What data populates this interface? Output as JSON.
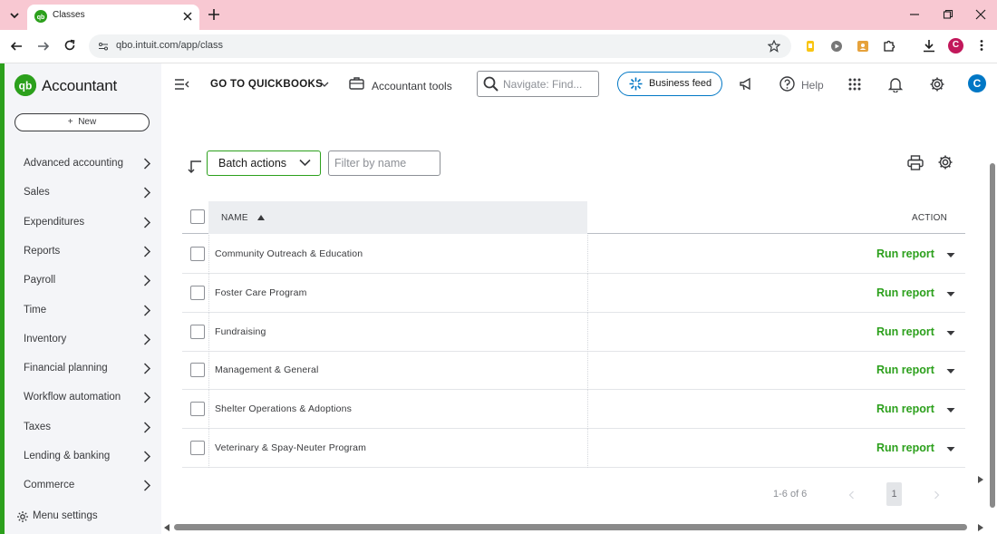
{
  "browser": {
    "tab_title": "Classes",
    "url": "qbo.intuit.com/app/class",
    "profile_initial": "C"
  },
  "sidebar": {
    "brand": "Accountant",
    "new_label": "New",
    "items": [
      {
        "label": "Advanced accounting"
      },
      {
        "label": "Sales"
      },
      {
        "label": "Expenditures"
      },
      {
        "label": "Reports"
      },
      {
        "label": "Payroll"
      },
      {
        "label": "Time"
      },
      {
        "label": "Inventory"
      },
      {
        "label": "Financial planning"
      },
      {
        "label": "Workflow automation"
      },
      {
        "label": "Taxes"
      },
      {
        "label": "Lending & banking"
      },
      {
        "label": "Commerce"
      }
    ],
    "menu_settings": "Menu settings"
  },
  "header": {
    "go_to_quickbooks": "GO TO QUICKBOOKS",
    "accountant_tools": "Accountant tools",
    "search_placeholder": "Navigate: Find...",
    "business_feed": "Business feed",
    "help": "Help",
    "avatar_initial": "C"
  },
  "toolbar": {
    "batch_actions": "Batch actions",
    "filter_placeholder": "Filter by name"
  },
  "table": {
    "col_name": "NAME",
    "col_action": "ACTION",
    "rows": [
      {
        "name": "Community Outreach & Education",
        "action": "Run report"
      },
      {
        "name": "Foster Care Program",
        "action": "Run report"
      },
      {
        "name": "Fundraising",
        "action": "Run report"
      },
      {
        "name": "Management & General",
        "action": "Run report"
      },
      {
        "name": "Shelter Operations & Adoptions",
        "action": "Run report"
      },
      {
        "name": "Veterinary & Spay-Neuter Program",
        "action": "Run report"
      }
    ]
  },
  "pagination": {
    "range": "1-6 of 6",
    "current_page": "1"
  },
  "colors": {
    "brand_green": "#2ca01c",
    "accent_blue": "#0077c5",
    "tabstrip_pink": "#f8c8d2"
  }
}
